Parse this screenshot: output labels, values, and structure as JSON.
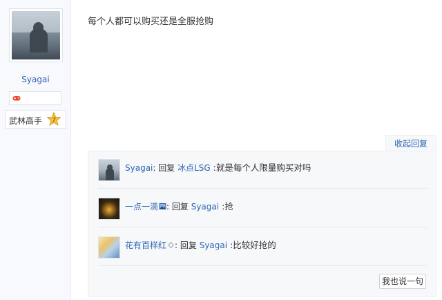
{
  "author": {
    "username": "Syagai",
    "level_title": "武林高手",
    "level_number": "7"
  },
  "post": {
    "content": "每个人都可以购买还是全服抢购"
  },
  "replies_panel": {
    "collapse_label": "收起回复",
    "say_button_label": "我也说一句",
    "items": [
      {
        "nick": "Syagai",
        "sep": ":",
        "reply_word": " 回复 ",
        "target": "冰点LSG",
        "content": " :就是每个人限量购买对吗"
      },
      {
        "nick": "一点一滴",
        "sep": ":",
        "reply_word": " 回复 ",
        "target": "Syagai",
        "content": " :抢"
      },
      {
        "nick": "花有百样红",
        "sep": ":",
        "reply_word": " 回复 ",
        "target": "Syagai",
        "content": " :比较好抢的"
      }
    ]
  },
  "colors": {
    "link": "#2d64b3",
    "panel_bg": "#f7f8fa"
  }
}
